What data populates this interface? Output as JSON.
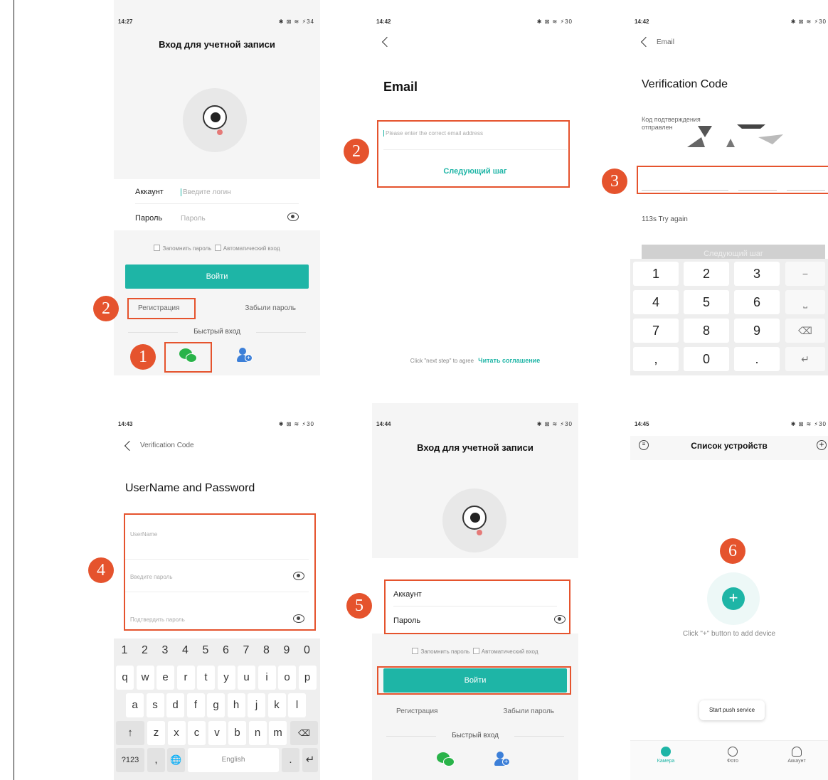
{
  "screen1": {
    "time": "14:27",
    "status_icons": "✱ ⊠ ≋ ⚡34",
    "title": "Вход для учетной записи",
    "account_label": "Аккаунт",
    "account_placeholder": "Введите логин",
    "password_label": "Пароль",
    "password_placeholder": "Пароль",
    "remember_label": "Запомнить пароль",
    "auto_login_label": "Автоматический вход",
    "login_button": "Войти",
    "register_link": "Регистрация",
    "forgot_link": "Забыли пароль",
    "quick_login": "Быстрый вход",
    "badge_register": "2",
    "badge_wechat": "1"
  },
  "screen2": {
    "time": "14:42",
    "status_icons": "✱ ⊠ ≋ ⚡30",
    "title": "Email",
    "email_placeholder": "Please enter the correct email address",
    "next_step": "Следующий шаг",
    "agree_text": "Click \"next step\" to agree",
    "agreement_link": "Читать соглашение",
    "badge": "2"
  },
  "screen3": {
    "time": "14:42",
    "status_icons": "✱ ⊠ ≋ ⚡30",
    "back_label": "Email",
    "title": "Verification Code",
    "sent_line1": "Код подтверждения",
    "sent_line2": "отправлен",
    "retry": "113s Try again",
    "next_step": "Следующий шаг",
    "badge": "3",
    "keys": [
      [
        "1",
        "2",
        "3",
        "−"
      ],
      [
        "4",
        "5",
        "6",
        "⎵"
      ],
      [
        "7",
        "8",
        "9",
        "⌫"
      ],
      [
        ",",
        "0",
        ".",
        "↵"
      ]
    ]
  },
  "screen4": {
    "time": "14:43",
    "status_icons": "✱ ⊠ ≋ ⚡30",
    "back_label": "Verification Code",
    "title": "UserName and Password",
    "username_placeholder": "UserName",
    "password_placeholder": "Введите пароль",
    "confirm_placeholder": "Подтвердить пароль",
    "badge": "4",
    "numbers": [
      "1",
      "2",
      "3",
      "4",
      "5",
      "6",
      "7",
      "8",
      "9",
      "0"
    ],
    "row1": [
      "q",
      "w",
      "e",
      "r",
      "t",
      "y",
      "u",
      "i",
      "o",
      "p"
    ],
    "row2": [
      "a",
      "s",
      "d",
      "f",
      "g",
      "h",
      "j",
      "k",
      "l"
    ],
    "row3": [
      "z",
      "x",
      "c",
      "v",
      "b",
      "n",
      "m"
    ],
    "shift_key": "↑",
    "backspace_key": "⌫",
    "sym_key": "?123",
    "comma_key": ",",
    "globe_key": "🌐",
    "space_key": "English",
    "period_key": ".",
    "enter_key": "↵"
  },
  "screen5": {
    "time": "14:44",
    "status_icons": "✱ ⊠ ≋ ⚡30",
    "title": "Вход для учетной записи",
    "account_label": "Аккаунт",
    "password_label": "Пароль",
    "remember_label": "Запомнить пароль",
    "auto_login_label": "Автоматический вход",
    "login_button": "Войти",
    "register_link": "Регистрация",
    "forgot_link": "Забыли пароль",
    "quick_login": "Быстрый вход",
    "badge": "5"
  },
  "screen6": {
    "time": "14:45",
    "status_icons": "✱ ⊠ ≋ ⚡30",
    "title": "Список устройств",
    "add_hint": "Click \"+\" button to add device",
    "push_service": "Start push service",
    "badge": "6",
    "tab_camera": "Камера",
    "tab_photo": "Фото",
    "tab_account": "Аккаунт"
  },
  "colors": {
    "teal": "#1eb5a6",
    "annotation_red": "#e5532d",
    "wechat_green": "#29b349",
    "user_blue": "#3c7fd8"
  }
}
